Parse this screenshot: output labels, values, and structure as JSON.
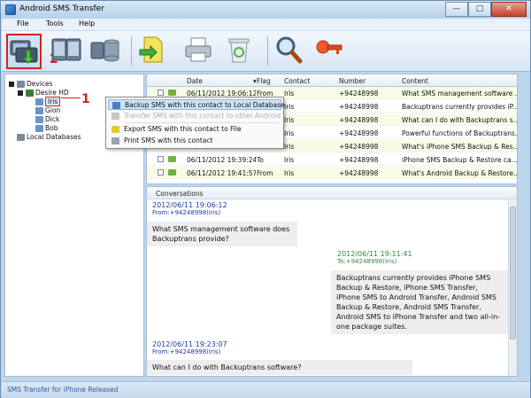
{
  "window": {
    "title": "Android SMS Transfer"
  },
  "menu": [
    "File",
    "Tools",
    "Help"
  ],
  "toolbar_step": "2",
  "tree": {
    "devices": "Devices",
    "device": "Desire HD",
    "contacts": [
      "Iris",
      "Gion",
      "Dick",
      "Bob"
    ],
    "local": "Local Databases",
    "step": "1"
  },
  "context_menu": {
    "items": [
      "Backup SMS with this contact to Local Database",
      "Transfer SMS with this contact to other Android",
      "Export SMS with this contact to File",
      "Print SMS with this contact"
    ]
  },
  "grid": {
    "columns": [
      "Date",
      "Flag",
      "Contact",
      "Number",
      "Content"
    ],
    "rows": [
      [
        "06/11/2012 19:06:12",
        "From",
        "Iris",
        "+94248998",
        "What SMS management software ..."
      ],
      [
        "06/11/2012 19:11:41",
        "To",
        "Iris",
        "+94248998",
        "Backuptrans currently provides iP..."
      ],
      [
        "06/11/2012 19:23:07",
        "From",
        "Iris",
        "+94248998",
        "What can I do with Backuptrans s..."
      ],
      [
        "06/11/2012 19:29:42",
        "To",
        "Iris",
        "+94248998",
        "Powerful functions of Backuptrans..."
      ],
      [
        "06/11/2012 19:34:00",
        "From",
        "Iris",
        "+94248998",
        "What's iPhone SMS Backup & Res..."
      ],
      [
        "06/11/2012 19:39:24",
        "To",
        "Iris",
        "+94248998",
        "iPhone SMS Backup & Restore ca..."
      ],
      [
        "06/11/2012 19:41:57",
        "From",
        "Iris",
        "+94248998",
        "What's Android Backup & Restore..."
      ]
    ]
  },
  "conversations": {
    "title": "Conversations",
    "messages": [
      {
        "time": "2012/06/11 19:06:12",
        "from": "From:+94248998(Iris)",
        "text": "What SMS management software does Backuptrans provide?"
      },
      {
        "time": "2012/06/11 19:11:41",
        "from": "To:+94248998(Iris)",
        "text": "Backuptrans currently provides iPhone SMS Backup & Restore, iPhone SMS Transfer, iPhone SMS to Android Transfer, Android SMS Backup & Restore, Android SMS Transfer, Android SMS to iPhone Transfer and two all-in-one package suites."
      },
      {
        "time": "2012/06/11 19:23:07",
        "from": "From:+94248998(Iris)",
        "text": "What can I do with Backuptrans software?"
      }
    ]
  },
  "status": "SMS Transfer for iPhone Released",
  "colors": {
    "annotation": "#d62020",
    "link": "#1e3aa8",
    "status": "#2f5aa0"
  }
}
